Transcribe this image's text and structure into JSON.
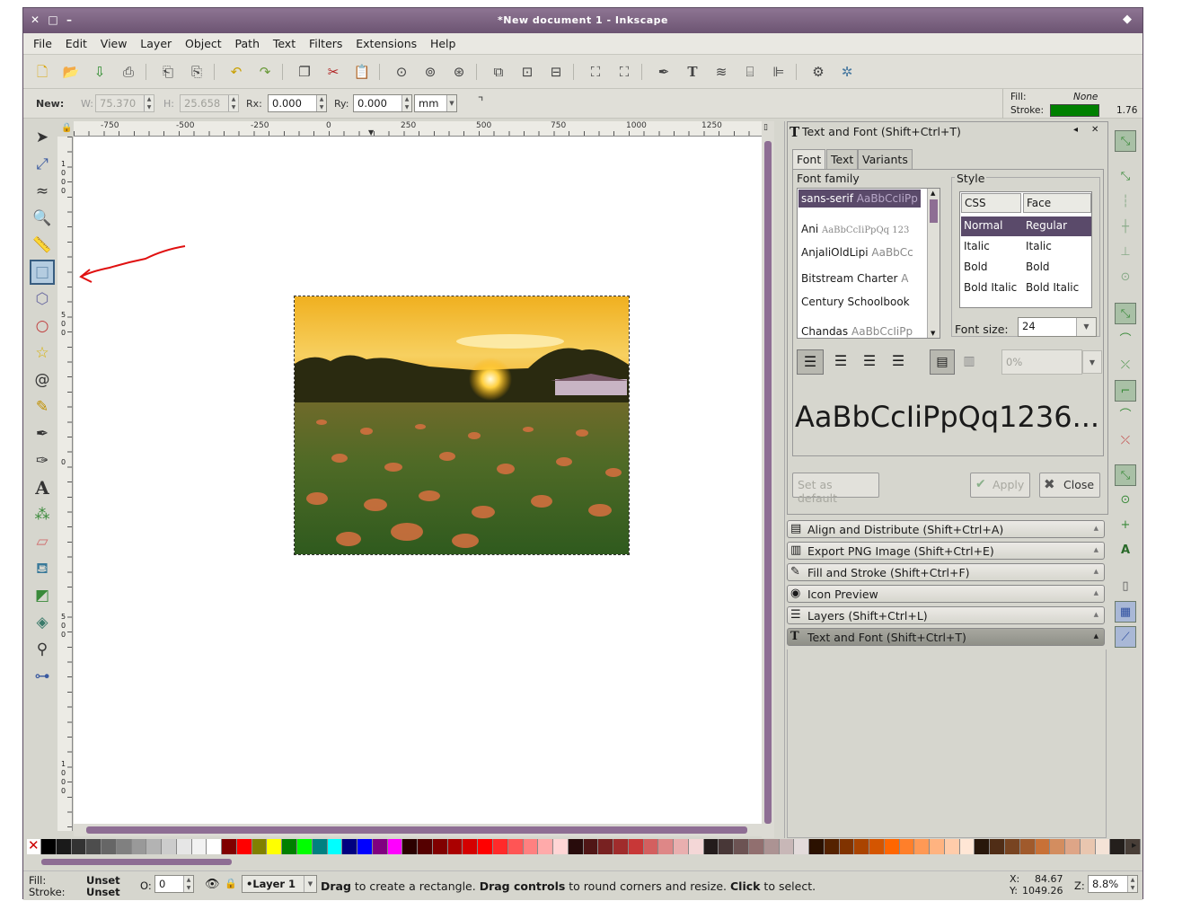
{
  "window": {
    "title": "*New document 1 - Inkscape"
  },
  "menu": [
    "File",
    "Edit",
    "View",
    "Layer",
    "Object",
    "Path",
    "Text",
    "Filters",
    "Extensions",
    "Help"
  ],
  "controls": {
    "new_label": "New:",
    "w_label": "W:",
    "w_value": "75.370",
    "h_label": "H:",
    "h_value": "25.658",
    "rx_label": "Rx:",
    "rx_value": "0.000",
    "ry_label": "Ry:",
    "ry_value": "0.000",
    "unit": "mm"
  },
  "style_indicator": {
    "fill_label": "Fill:",
    "fill_value": "None",
    "stroke_label": "Stroke:",
    "stroke_color": "#008000",
    "stroke_width": "1.76"
  },
  "ruler_top": [
    "-750",
    "-500",
    "-250",
    "0",
    "250",
    "500",
    "750",
    "1000",
    "1250"
  ],
  "ruler_left": [
    "1",
    "0",
    "0",
    "5",
    "0",
    "0",
    "0",
    "5",
    "0",
    "0",
    "1",
    "0",
    "0",
    "0"
  ],
  "text_font_panel": {
    "header": "Text and Font (Shift+Ctrl+T)",
    "tabs": [
      "Font",
      "Text",
      "Variants"
    ],
    "font_family_label": "Font family",
    "fonts": [
      {
        "name": "sans-serif",
        "preview": "AaBbCcIiPp"
      },
      {
        "name": "Ani",
        "preview": "AaBbCcIiPpQq 123"
      },
      {
        "name": "AnjaliOldLipi",
        "preview": "AaBbCc"
      },
      {
        "name": "Bitstream Charter",
        "preview": "A"
      },
      {
        "name": "Century Schoolbook",
        "preview": ""
      },
      {
        "name": "Chandas",
        "preview": "AaBbCcIiPp"
      }
    ],
    "style_label": "Style",
    "style_headers": [
      "CSS",
      "Face"
    ],
    "styles": [
      [
        "Normal",
        "Regular"
      ],
      [
        "Italic",
        "Italic"
      ],
      [
        "Bold",
        "Bold"
      ],
      [
        "Bold Italic",
        "Bold Italic"
      ]
    ],
    "font_size_label": "Font size:",
    "font_size": "24",
    "spacing_value": "0%",
    "preview_text": "AaBbCcIiPpQq1236...",
    "set_default": "Set as default",
    "apply": "Apply",
    "close": "Close"
  },
  "dock_items": [
    {
      "label": "Align and Distribute (Shift+Ctrl+A)",
      "icon": "▤"
    },
    {
      "label": "Export PNG Image (Shift+Ctrl+E)",
      "icon": "▥"
    },
    {
      "label": "Fill and Stroke (Shift+Ctrl+F)",
      "icon": "✎"
    },
    {
      "label": "Icon Preview",
      "icon": "◉"
    },
    {
      "label": "Layers (Shift+Ctrl+L)",
      "icon": "☰"
    },
    {
      "label": "Text and Font (Shift+Ctrl+T)",
      "icon": "T"
    }
  ],
  "palette": [
    "#000000",
    "#1a1a1a",
    "#333333",
    "#4d4d4d",
    "#666666",
    "#808080",
    "#999999",
    "#b3b3b3",
    "#cccccc",
    "#e6e6e6",
    "#f2f2f2",
    "#ffffff",
    "#800000",
    "#ff0000",
    "#808000",
    "#ffff00",
    "#008000",
    "#00ff00",
    "#008080",
    "#00ffff",
    "#000080",
    "#0000ff",
    "#800080",
    "#ff00ff",
    "#2b0000",
    "#550000",
    "#800000",
    "#aa0000",
    "#d40000",
    "#ff0000",
    "#ff2a2a",
    "#ff5555",
    "#ff8080",
    "#ffaaaa",
    "#ffd5d5",
    "#280b0b",
    "#501616",
    "#782121",
    "#a02c2c",
    "#c83737",
    "#d35f5f",
    "#de8787",
    "#e9afaf",
    "#f4d7d7",
    "#241c1c",
    "#483737",
    "#6c5353",
    "#916f6f",
    "#ac9393",
    "#c8b7b7",
    "#e3dbdb",
    "#2b1100",
    "#552200",
    "#803300",
    "#aa4400",
    "#d45500",
    "#ff6600",
    "#ff7f2a",
    "#ff9955",
    "#ffb380",
    "#ffccaa",
    "#ffe6d5",
    "#28170b",
    "#502d16",
    "#784421",
    "#a05a2c",
    "#c87137",
    "#d38d5f",
    "#dea587",
    "#e9c6af",
    "#f4e3d7",
    "#241f1c",
    "#483e37"
  ],
  "status": {
    "fill_label": "Fill:",
    "fill_value": "Unset",
    "stroke_label": "Stroke:",
    "stroke_value": "Unset",
    "opacity_label": "O:",
    "opacity_value": "0",
    "layer": "•Layer 1",
    "msg1": "Drag",
    "msg2": " to create a rectangle. ",
    "msg3": "Drag controls",
    "msg4": " to round corners and resize. ",
    "msg5": "Click",
    "msg6": " to select.",
    "x_label": "X:",
    "x_value": "84.67",
    "y_label": "Y:",
    "y_value": "1049.26",
    "z_label": "Z:",
    "zoom": "8.8%"
  }
}
